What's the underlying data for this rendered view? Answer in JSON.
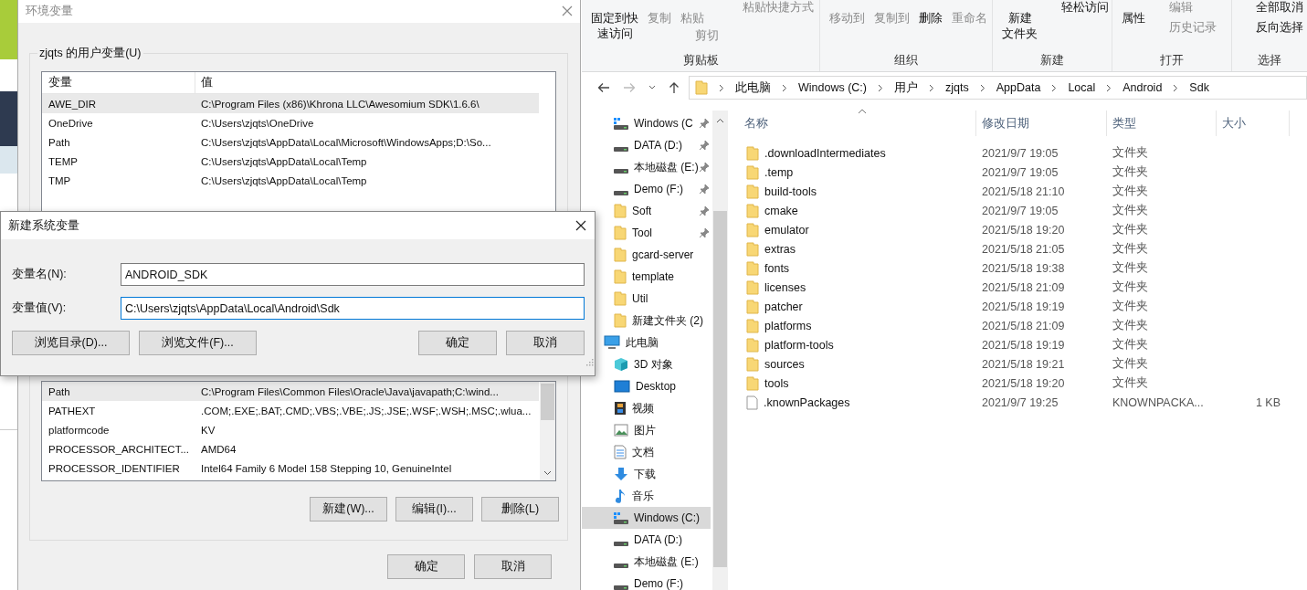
{
  "env_dialog": {
    "title": "环境变量",
    "user_group": "zjqts 的用户变量(U)",
    "columns": [
      "变量",
      "值"
    ],
    "user_rows": [
      {
        "name": "AWE_DIR",
        "value": "C:\\Program Files (x86)\\Khrona LLC\\Awesomium SDK\\1.6.6\\",
        "selected": true
      },
      {
        "name": "OneDrive",
        "value": "C:\\Users\\zjqts\\OneDrive",
        "selected": false
      },
      {
        "name": "Path",
        "value": "C:\\Users\\zjqts\\AppData\\Local\\Microsoft\\WindowsApps;D:\\So...",
        "selected": false
      },
      {
        "name": "TEMP",
        "value": "C:\\Users\\zjqts\\AppData\\Local\\Temp",
        "selected": false
      },
      {
        "name": "TMP",
        "value": "C:\\Users\\zjqts\\AppData\\Local\\Temp",
        "selected": false
      }
    ],
    "system_rows": [
      {
        "name": "Path",
        "value": "C:\\Program Files\\Common Files\\Oracle\\Java\\javapath;C:\\wind...",
        "selected": true
      },
      {
        "name": "PATHEXT",
        "value": ".COM;.EXE;.BAT;.CMD;.VBS;.VBE;.JS;.JSE;.WSF;.WSH;.MSC;.wlua...",
        "selected": false
      },
      {
        "name": "platformcode",
        "value": "KV",
        "selected": false
      },
      {
        "name": "PROCESSOR_ARCHITECT...",
        "value": "AMD64",
        "selected": false
      },
      {
        "name": "PROCESSOR_IDENTIFIER",
        "value": "Intel64 Family 6 Model 158 Stepping 10, GenuineIntel",
        "selected": false
      }
    ],
    "system_buttons": [
      "新建(W)...",
      "编辑(I)...",
      "删除(L)"
    ],
    "buttons": [
      "确定",
      "取消"
    ]
  },
  "new_var_dialog": {
    "title": "新建系统变量",
    "fields": [
      {
        "label": "变量名(N):",
        "value": "ANDROID_SDK",
        "focused": false
      },
      {
        "label": "变量值(V):",
        "value": "C:\\Users\\zjqts\\AppData\\Local\\Android\\Sdk",
        "focused": true
      }
    ],
    "browse_buttons": [
      "浏览目录(D)...",
      "浏览文件(F)..."
    ],
    "buttons": [
      "确定",
      "取消"
    ]
  },
  "explorer": {
    "ribbon": [
      {
        "label": "剪贴板",
        "columns": [
          [
            {
              "lines": [
                "固定到快",
                "速访问"
              ],
              "kind": "large",
              "disabled": false
            }
          ],
          [
            {
              "label": "复制",
              "kind": "large",
              "disabled": true
            }
          ],
          [
            {
              "label": "粘贴",
              "kind": "large",
              "disabled": true
            },
            {
              "label": "剪切",
              "kind": "small",
              "disabled": true
            }
          ],
          [
            {
              "label": "粘贴快捷方式",
              "kind": "small",
              "disabled": true
            }
          ]
        ]
      },
      {
        "label": "组织",
        "columns": [
          [
            {
              "label": "移动到",
              "kind": "large",
              "disabled": true
            }
          ],
          [
            {
              "label": "复制到",
              "kind": "large",
              "disabled": true
            }
          ],
          [
            {
              "label": "删除",
              "kind": "large",
              "disabled": false
            }
          ],
          [
            {
              "label": "重命名",
              "kind": "large",
              "disabled": true
            }
          ]
        ]
      },
      {
        "label": "新建",
        "columns": [
          [
            {
              "lines": [
                "新建",
                "文件夹"
              ],
              "kind": "large",
              "disabled": false
            }
          ],
          [
            {
              "label": "轻松访问",
              "kind": "small",
              "disabled": false
            }
          ]
        ]
      },
      {
        "label": "打开",
        "columns": [
          [
            {
              "label": "属性",
              "kind": "large",
              "disabled": false
            }
          ],
          [
            {
              "label": "编辑",
              "kind": "small",
              "disabled": true
            },
            {
              "label": "历史记录",
              "kind": "small",
              "disabled": true
            }
          ]
        ]
      },
      {
        "label": "选择",
        "columns": [
          [
            {
              "label": "全部取消",
              "kind": "small",
              "disabled": false
            },
            {
              "label": "反向选择",
              "kind": "small",
              "disabled": false
            }
          ]
        ]
      }
    ],
    "breadcrumb": [
      "此电脑",
      "Windows (C:)",
      "用户",
      "zjqts",
      "AppData",
      "Local",
      "Android",
      "Sdk"
    ],
    "nav": [
      {
        "label": "Windows (C",
        "kind": "drive-win",
        "pinned": true,
        "selected": false
      },
      {
        "label": "DATA (D:)",
        "kind": "drive",
        "pinned": true,
        "selected": false
      },
      {
        "label": "本地磁盘 (E:)",
        "kind": "drive",
        "pinned": true,
        "selected": false
      },
      {
        "label": "Demo (F:)",
        "kind": "drive",
        "pinned": true,
        "selected": false
      },
      {
        "label": "Soft",
        "kind": "folder",
        "pinned": true,
        "selected": false
      },
      {
        "label": "Tool",
        "kind": "folder",
        "pinned": true,
        "selected": false
      },
      {
        "label": "gcard-server",
        "kind": "folder",
        "pinned": false,
        "selected": false
      },
      {
        "label": "template",
        "kind": "folder",
        "pinned": false,
        "selected": false
      },
      {
        "label": "Util",
        "kind": "folder",
        "pinned": false,
        "selected": false
      },
      {
        "label": "新建文件夹 (2)",
        "kind": "folder",
        "pinned": false,
        "selected": false
      },
      {
        "label": "此电脑",
        "kind": "pc",
        "pinned": false,
        "selected": false,
        "children": [
          {
            "label": "3D 对象",
            "kind": "cube",
            "pinned": false,
            "selected": false
          },
          {
            "label": "Desktop",
            "kind": "desktop",
            "pinned": false,
            "selected": false
          },
          {
            "label": "视频",
            "kind": "video",
            "pinned": false,
            "selected": false
          },
          {
            "label": "图片",
            "kind": "picture",
            "pinned": false,
            "selected": false
          },
          {
            "label": "文档",
            "kind": "document",
            "pinned": false,
            "selected": false
          },
          {
            "label": "下载",
            "kind": "download",
            "pinned": false,
            "selected": false
          },
          {
            "label": "音乐",
            "kind": "music",
            "pinned": false,
            "selected": false
          },
          {
            "label": "Windows (C:)",
            "kind": "drive-win",
            "pinned": false,
            "selected": true
          },
          {
            "label": "DATA (D:)",
            "kind": "drive",
            "pinned": false,
            "selected": false
          },
          {
            "label": "本地磁盘 (E:)",
            "kind": "drive",
            "pinned": false,
            "selected": false
          },
          {
            "label": "Demo (F:)",
            "kind": "drive",
            "pinned": false,
            "selected": false
          }
        ]
      }
    ],
    "columns": [
      "名称",
      "修改日期",
      "类型",
      "大小"
    ],
    "files": [
      {
        "name": ".downloadIntermediates",
        "date": "2021/9/7 19:05",
        "type": "文件夹",
        "kind": "folder"
      },
      {
        "name": ".temp",
        "date": "2021/9/7 19:05",
        "type": "文件夹",
        "kind": "folder"
      },
      {
        "name": "build-tools",
        "date": "2021/5/18 21:10",
        "type": "文件夹",
        "kind": "folder"
      },
      {
        "name": "cmake",
        "date": "2021/9/7 19:05",
        "type": "文件夹",
        "kind": "folder"
      },
      {
        "name": "emulator",
        "date": "2021/5/18 19:20",
        "type": "文件夹",
        "kind": "folder"
      },
      {
        "name": "extras",
        "date": "2021/5/18 21:05",
        "type": "文件夹",
        "kind": "folder"
      },
      {
        "name": "fonts",
        "date": "2021/5/18 19:38",
        "type": "文件夹",
        "kind": "folder"
      },
      {
        "name": "licenses",
        "date": "2021/5/18 21:09",
        "type": "文件夹",
        "kind": "folder"
      },
      {
        "name": "patcher",
        "date": "2021/5/18 19:19",
        "type": "文件夹",
        "kind": "folder"
      },
      {
        "name": "platforms",
        "date": "2021/5/18 21:09",
        "type": "文件夹",
        "kind": "folder"
      },
      {
        "name": "platform-tools",
        "date": "2021/5/18 19:19",
        "type": "文件夹",
        "kind": "folder"
      },
      {
        "name": "sources",
        "date": "2021/5/18 19:21",
        "type": "文件夹",
        "kind": "folder"
      },
      {
        "name": "tools",
        "date": "2021/5/18 19:20",
        "type": "文件夹",
        "kind": "folder"
      },
      {
        "name": ".knownPackages",
        "date": "2021/9/7 19:25",
        "type": "KNOWNPACKA...",
        "size": "1 KB",
        "kind": "file"
      }
    ]
  }
}
